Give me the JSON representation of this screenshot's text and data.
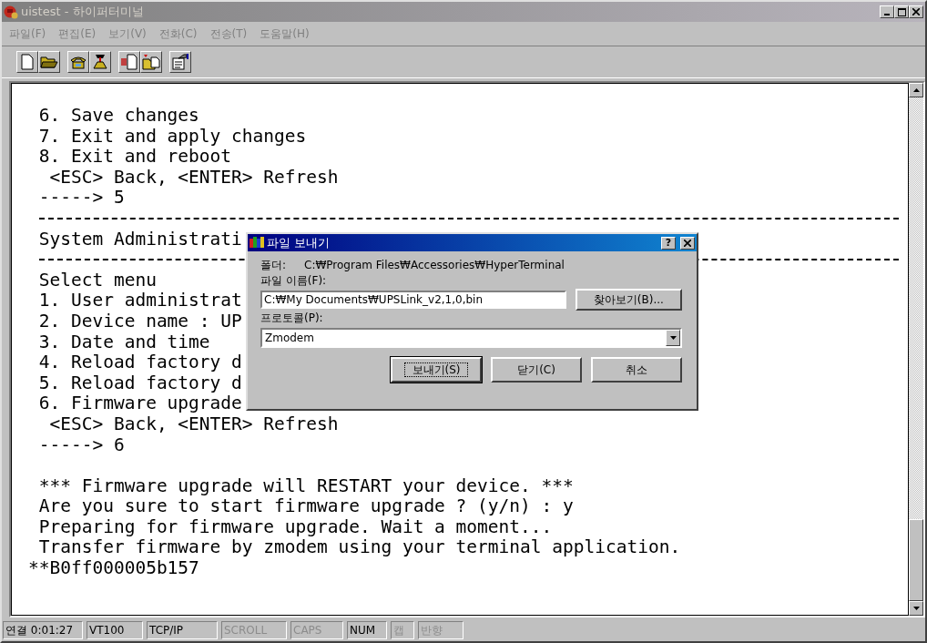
{
  "window": {
    "title": "uistest - 하이퍼터미널",
    "active": false
  },
  "menu": [
    "파일(F)",
    "편집(E)",
    "보기(V)",
    "전화(C)",
    "전송(T)",
    "도움말(H)"
  ],
  "terminal": {
    "lines": [
      {
        "kind": "text",
        "text": " 6. Save changes"
      },
      {
        "kind": "text",
        "text": " 7. Exit and apply changes"
      },
      {
        "kind": "text",
        "text": " 8. Exit and reboot"
      },
      {
        "kind": "text",
        "text": "  <ESC> Back, <ENTER> Refresh"
      },
      {
        "kind": "text",
        "text": " -----> 5"
      },
      {
        "kind": "rule"
      },
      {
        "kind": "text",
        "text": " System Administrati"
      },
      {
        "kind": "rule"
      },
      {
        "kind": "text",
        "text": " Select menu"
      },
      {
        "kind": "text",
        "text": " 1. User administrat"
      },
      {
        "kind": "text",
        "text": " 2. Device name : UP"
      },
      {
        "kind": "text",
        "text": " 3. Date and time"
      },
      {
        "kind": "text",
        "text": " 4. Reload factory d"
      },
      {
        "kind": "text",
        "text": " 5. Reload factory d"
      },
      {
        "kind": "text",
        "text": " 6. Firmware upgrade"
      },
      {
        "kind": "text",
        "text": "  <ESC> Back, <ENTER> Refresh"
      },
      {
        "kind": "text",
        "text": " -----> 6"
      },
      {
        "kind": "blank"
      },
      {
        "kind": "text",
        "text": " *** Firmware upgrade will RESTART your device. ***"
      },
      {
        "kind": "text",
        "text": " Are you sure to start firmware upgrade ? (y/n) : y"
      },
      {
        "kind": "text",
        "text": " Preparing for firmware upgrade. Wait a moment..."
      },
      {
        "kind": "text",
        "text": " Transfer firmware by zmodem using your terminal application."
      },
      {
        "kind": "text",
        "text": "**B0ff000005b157"
      }
    ]
  },
  "dialog": {
    "title": "파일 보내기",
    "help_button": "?",
    "folder_label": "폴더:",
    "folder_path": "C:₩Program Files₩Accessories₩HyperTerminal",
    "filename_label": "파일 이름(F):",
    "filename_value": "C:₩My Documents₩UPSLink_v2,1,0,bin",
    "browse_button": "찾아보기(B)...",
    "protocol_label": "프로토콜(P):",
    "protocol_value": "Zmodem",
    "buttons": [
      {
        "label": "보내기(S)",
        "default": true
      },
      {
        "label": "닫기(C)",
        "default": false
      },
      {
        "label": "취소",
        "default": false
      }
    ]
  },
  "status_bar": [
    {
      "text": "연결 0:01:27",
      "disabled": false
    },
    {
      "text": "VT100",
      "disabled": false
    },
    {
      "text": "TCP/IP",
      "disabled": false
    },
    {
      "text": "SCROLL",
      "disabled": true
    },
    {
      "text": "CAPS",
      "disabled": true
    },
    {
      "text": "NUM",
      "disabled": false
    },
    {
      "text": "캡",
      "disabled": true
    },
    {
      "text": "반향",
      "disabled": true
    }
  ]
}
